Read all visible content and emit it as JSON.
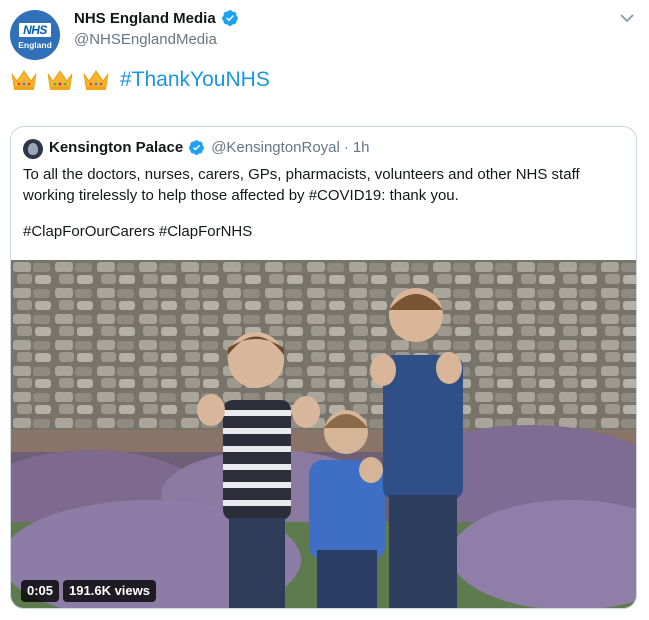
{
  "header": {
    "display_name": "NHS England Media",
    "handle": "@NHSEnglandMedia",
    "avatar_logo": "NHS",
    "avatar_sub": "England"
  },
  "tweet": {
    "hashtag": "#ThankYouNHS",
    "emoji": [
      "crown-icon",
      "crown-icon",
      "crown-icon"
    ]
  },
  "quoted": {
    "display_name": "Kensington Palace",
    "handle": "@KensingtonRoyal",
    "separator": "·",
    "time": "1h",
    "body": "To all the doctors, nurses, carers, GPs, pharmacists, volunteers and other NHS staff working tirelessly to help those affected by #COVID19: thank you.",
    "tags": "#ClapForOurCarers #ClapForNHS",
    "video": {
      "duration": "0:05",
      "views": "191.6K views"
    }
  },
  "colors": {
    "link": "#1b95e0",
    "verified": "#1da1f2",
    "muted": "#657786",
    "nhs_blue": "#005eb8"
  }
}
